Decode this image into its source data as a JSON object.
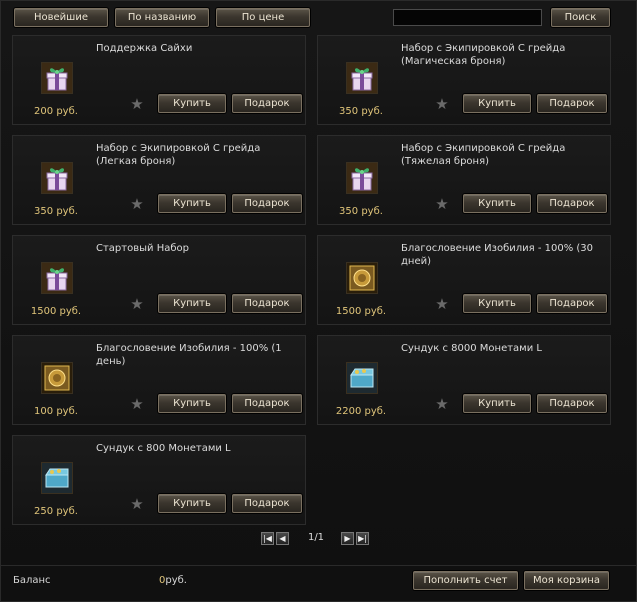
{
  "toolbar": {
    "sort_newest": "Новейшие",
    "sort_name": "По названию",
    "sort_price": "По цене",
    "search_value": "",
    "search_button": "Поиск"
  },
  "items": [
    {
      "title": "Поддержка Сайхи",
      "price": "200 руб.",
      "icon": "gift-box-icon",
      "buy": "Купить",
      "gift": "Подарок"
    },
    {
      "title": "Набор с Экипировкой С грейда (Магическая броня)",
      "price": "350 руб.",
      "icon": "gift-box-icon",
      "buy": "Купить",
      "gift": "Подарок"
    },
    {
      "title": "Набор с Экипировкой С грейда (Легкая броня)",
      "price": "350 руб.",
      "icon": "gift-box-icon",
      "buy": "Купить",
      "gift": "Подарок"
    },
    {
      "title": "Набор с Экипировкой С грейда (Тяжелая броня)",
      "price": "350 руб.",
      "icon": "gift-box-icon",
      "buy": "Купить",
      "gift": "Подарок"
    },
    {
      "title": "Стартовый Набор",
      "price": "1500 руб.",
      "icon": "gift-box-icon",
      "buy": "Купить",
      "gift": "Подарок"
    },
    {
      "title": "Благословение Изобилия - 100% (30 дней)",
      "price": "1500 руб.",
      "icon": "golden-seal-icon",
      "buy": "Купить",
      "gift": "Подарок"
    },
    {
      "title": "Благословение Изобилия - 100% (1 день)",
      "price": "100 руб.",
      "icon": "golden-seal-icon",
      "buy": "Купить",
      "gift": "Подарок"
    },
    {
      "title": "Сундук с 8000 Монетами L",
      "price": "2200 руб.",
      "icon": "coin-chest-icon",
      "buy": "Купить",
      "gift": "Подарок"
    },
    {
      "title": "Сундук с 800 Монетами L",
      "price": "250 руб.",
      "icon": "coin-chest-icon",
      "buy": "Купить",
      "gift": "Подарок"
    }
  ],
  "pagination": {
    "page": "1/1",
    "first_icon": "first-page-icon",
    "prev_icon": "prev-page-icon",
    "next_icon": "next-page-icon",
    "last_icon": "last-page-icon"
  },
  "footer": {
    "balance_label": "Баланс",
    "balance_amount": "0",
    "balance_currency": "руб.",
    "topup_button": "Пополнить счет",
    "cart_button": "Моя корзина"
  },
  "colors": {
    "price": "#e0c57a",
    "button_border": "#7a7060",
    "card_bg": "#1b1b1b"
  }
}
